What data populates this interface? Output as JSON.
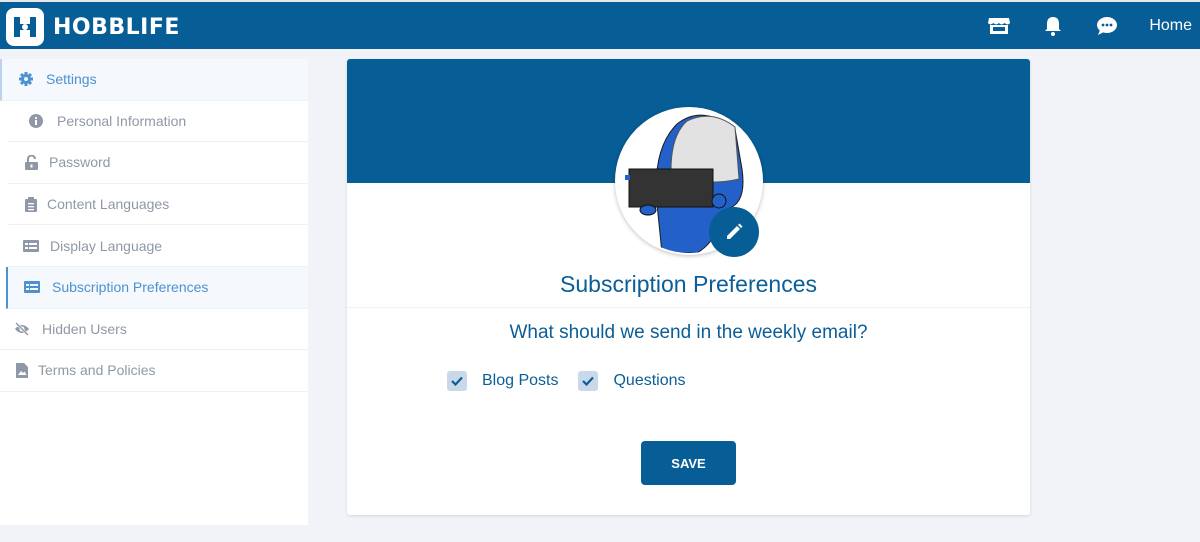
{
  "header": {
    "brand": "HOBBLIFE",
    "icons": [
      "store-icon",
      "bell-icon",
      "chat-icon"
    ],
    "home_label": "Home"
  },
  "sidebar": {
    "items": [
      {
        "label": "Settings",
        "icon": "gear-icon",
        "state": "section"
      },
      {
        "label": "Personal Information",
        "icon": "info-icon",
        "state": "normal"
      },
      {
        "label": "Password",
        "icon": "unlock-icon",
        "state": "normal"
      },
      {
        "label": "Content Languages",
        "icon": "clipboard-icon",
        "state": "normal"
      },
      {
        "label": "Display Language",
        "icon": "list-card-icon",
        "state": "normal"
      },
      {
        "label": "Subscription Preferences",
        "icon": "list-card-icon",
        "state": "active"
      },
      {
        "label": "Hidden Users",
        "icon": "eye-slash-icon",
        "state": "normal"
      },
      {
        "label": "Terms and Policies",
        "icon": "document-icon",
        "state": "normal"
      }
    ]
  },
  "main": {
    "title": "Subscription Preferences",
    "question": "What should we send in the weekly email?",
    "options": [
      {
        "label": "Blog Posts",
        "checked": true
      },
      {
        "label": "Questions",
        "checked": true
      }
    ],
    "save_label": "SAVE"
  },
  "colors": {
    "brand": "#075e96",
    "accent": "#4c92d0",
    "checkbox": "#c9d9ea"
  }
}
